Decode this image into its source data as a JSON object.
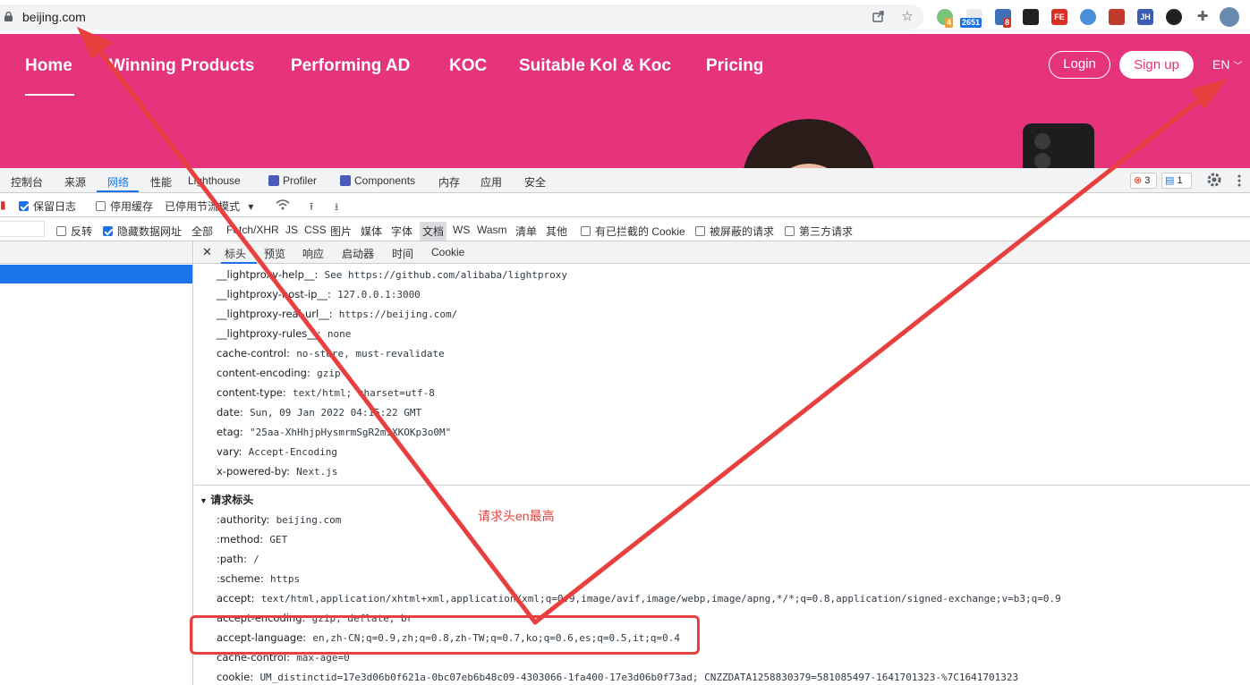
{
  "browser": {
    "url": "beijing.com",
    "ext_badges": [
      "4",
      "2651",
      "8"
    ],
    "ext_labels": [
      "FE",
      "JH"
    ]
  },
  "site": {
    "nav": [
      "Home",
      "Winning Products",
      "Performing AD",
      "KOC",
      "Suitable Kol & Koc",
      "Pricing"
    ],
    "login": "Login",
    "signup": "Sign up",
    "lang": "EN",
    "brand_color": "#e5337c"
  },
  "devtools": {
    "tabs": [
      "控制台",
      "来源",
      "网络",
      "性能",
      "Lighthouse",
      "Profiler",
      "Components",
      "内存",
      "应用",
      "安全"
    ],
    "active_tab": "网络",
    "error_count": "3",
    "message_count": "1",
    "toolbar": {
      "preserve_log": "保留日志",
      "disable_cache": "停用缓存",
      "throttle": "已停用节流模式"
    },
    "filter": {
      "invert": "反转",
      "hide_data_urls": "隐藏数据网址",
      "types": [
        "全部",
        "Fetch/XHR",
        "JS",
        "CSS",
        "图片",
        "媒体",
        "字体",
        "文档",
        "WS",
        "Wasm",
        "清单",
        "其他"
      ],
      "active_type": "文档",
      "blocked_cookies": "有已拦截的 Cookie",
      "blocked_requests": "被屏蔽的请求",
      "third_party": "第三方请求"
    },
    "detail_tabs": [
      "标头",
      "预览",
      "响应",
      "启动器",
      "时间",
      "Cookie"
    ],
    "response_headers": [
      {
        "name": "__lightproxy-help__:",
        "value": "See https://github.com/alibaba/lightproxy"
      },
      {
        "name": "__lightproxy-host-ip__:",
        "value": "127.0.0.1:3000"
      },
      {
        "name": "__lightproxy-real-url__:",
        "value": "https://beijing.com/"
      },
      {
        "name": "__lightproxy-rules__:",
        "value": "none"
      },
      {
        "name": "cache-control:",
        "value": "no-store, must-revalidate"
      },
      {
        "name": "content-encoding:",
        "value": "gzip"
      },
      {
        "name": "content-type:",
        "value": "text/html; charset=utf-8"
      },
      {
        "name": "date:",
        "value": "Sun, 09 Jan 2022 04:15:22 GMT"
      },
      {
        "name": "etag:",
        "value": "\"25aa-XhHhjpHysmrmSgR2m1XKOKp3o0M\""
      },
      {
        "name": "vary:",
        "value": "Accept-Encoding"
      },
      {
        "name": "x-powered-by:",
        "value": "Next.js"
      }
    ],
    "request_section_title": "请求标头",
    "request_headers": [
      {
        "name": ":authority:",
        "value": "beijing.com"
      },
      {
        "name": ":method:",
        "value": "GET"
      },
      {
        "name": ":path:",
        "value": "/"
      },
      {
        "name": ":scheme:",
        "value": "https"
      },
      {
        "name": "accept:",
        "value": "text/html,application/xhtml+xml,application/xml;q=0.9,image/avif,image/webp,image/apng,*/*;q=0.8,application/signed-exchange;v=b3;q=0.9"
      },
      {
        "name": "accept-encoding:",
        "value": "gzip, deflate, br"
      },
      {
        "name": "accept-language:",
        "value": "en,zh-CN;q=0.9,zh;q=0.8,zh-TW;q=0.7,ko;q=0.6,es;q=0.5,it;q=0.4"
      },
      {
        "name": "cache-control:",
        "value": "max-age=0"
      },
      {
        "name": "cookie:",
        "value": "UM_distinctid=17e3d06b0f621a-0bc07eb6b48c09-4303066-1fa400-17e3d06b0f73ad; CNZZDATA1258830379=581085497-1641701323-%7C1641701323"
      }
    ]
  },
  "annotation": {
    "note": "请求头en最高",
    "color": "#e8403e"
  }
}
